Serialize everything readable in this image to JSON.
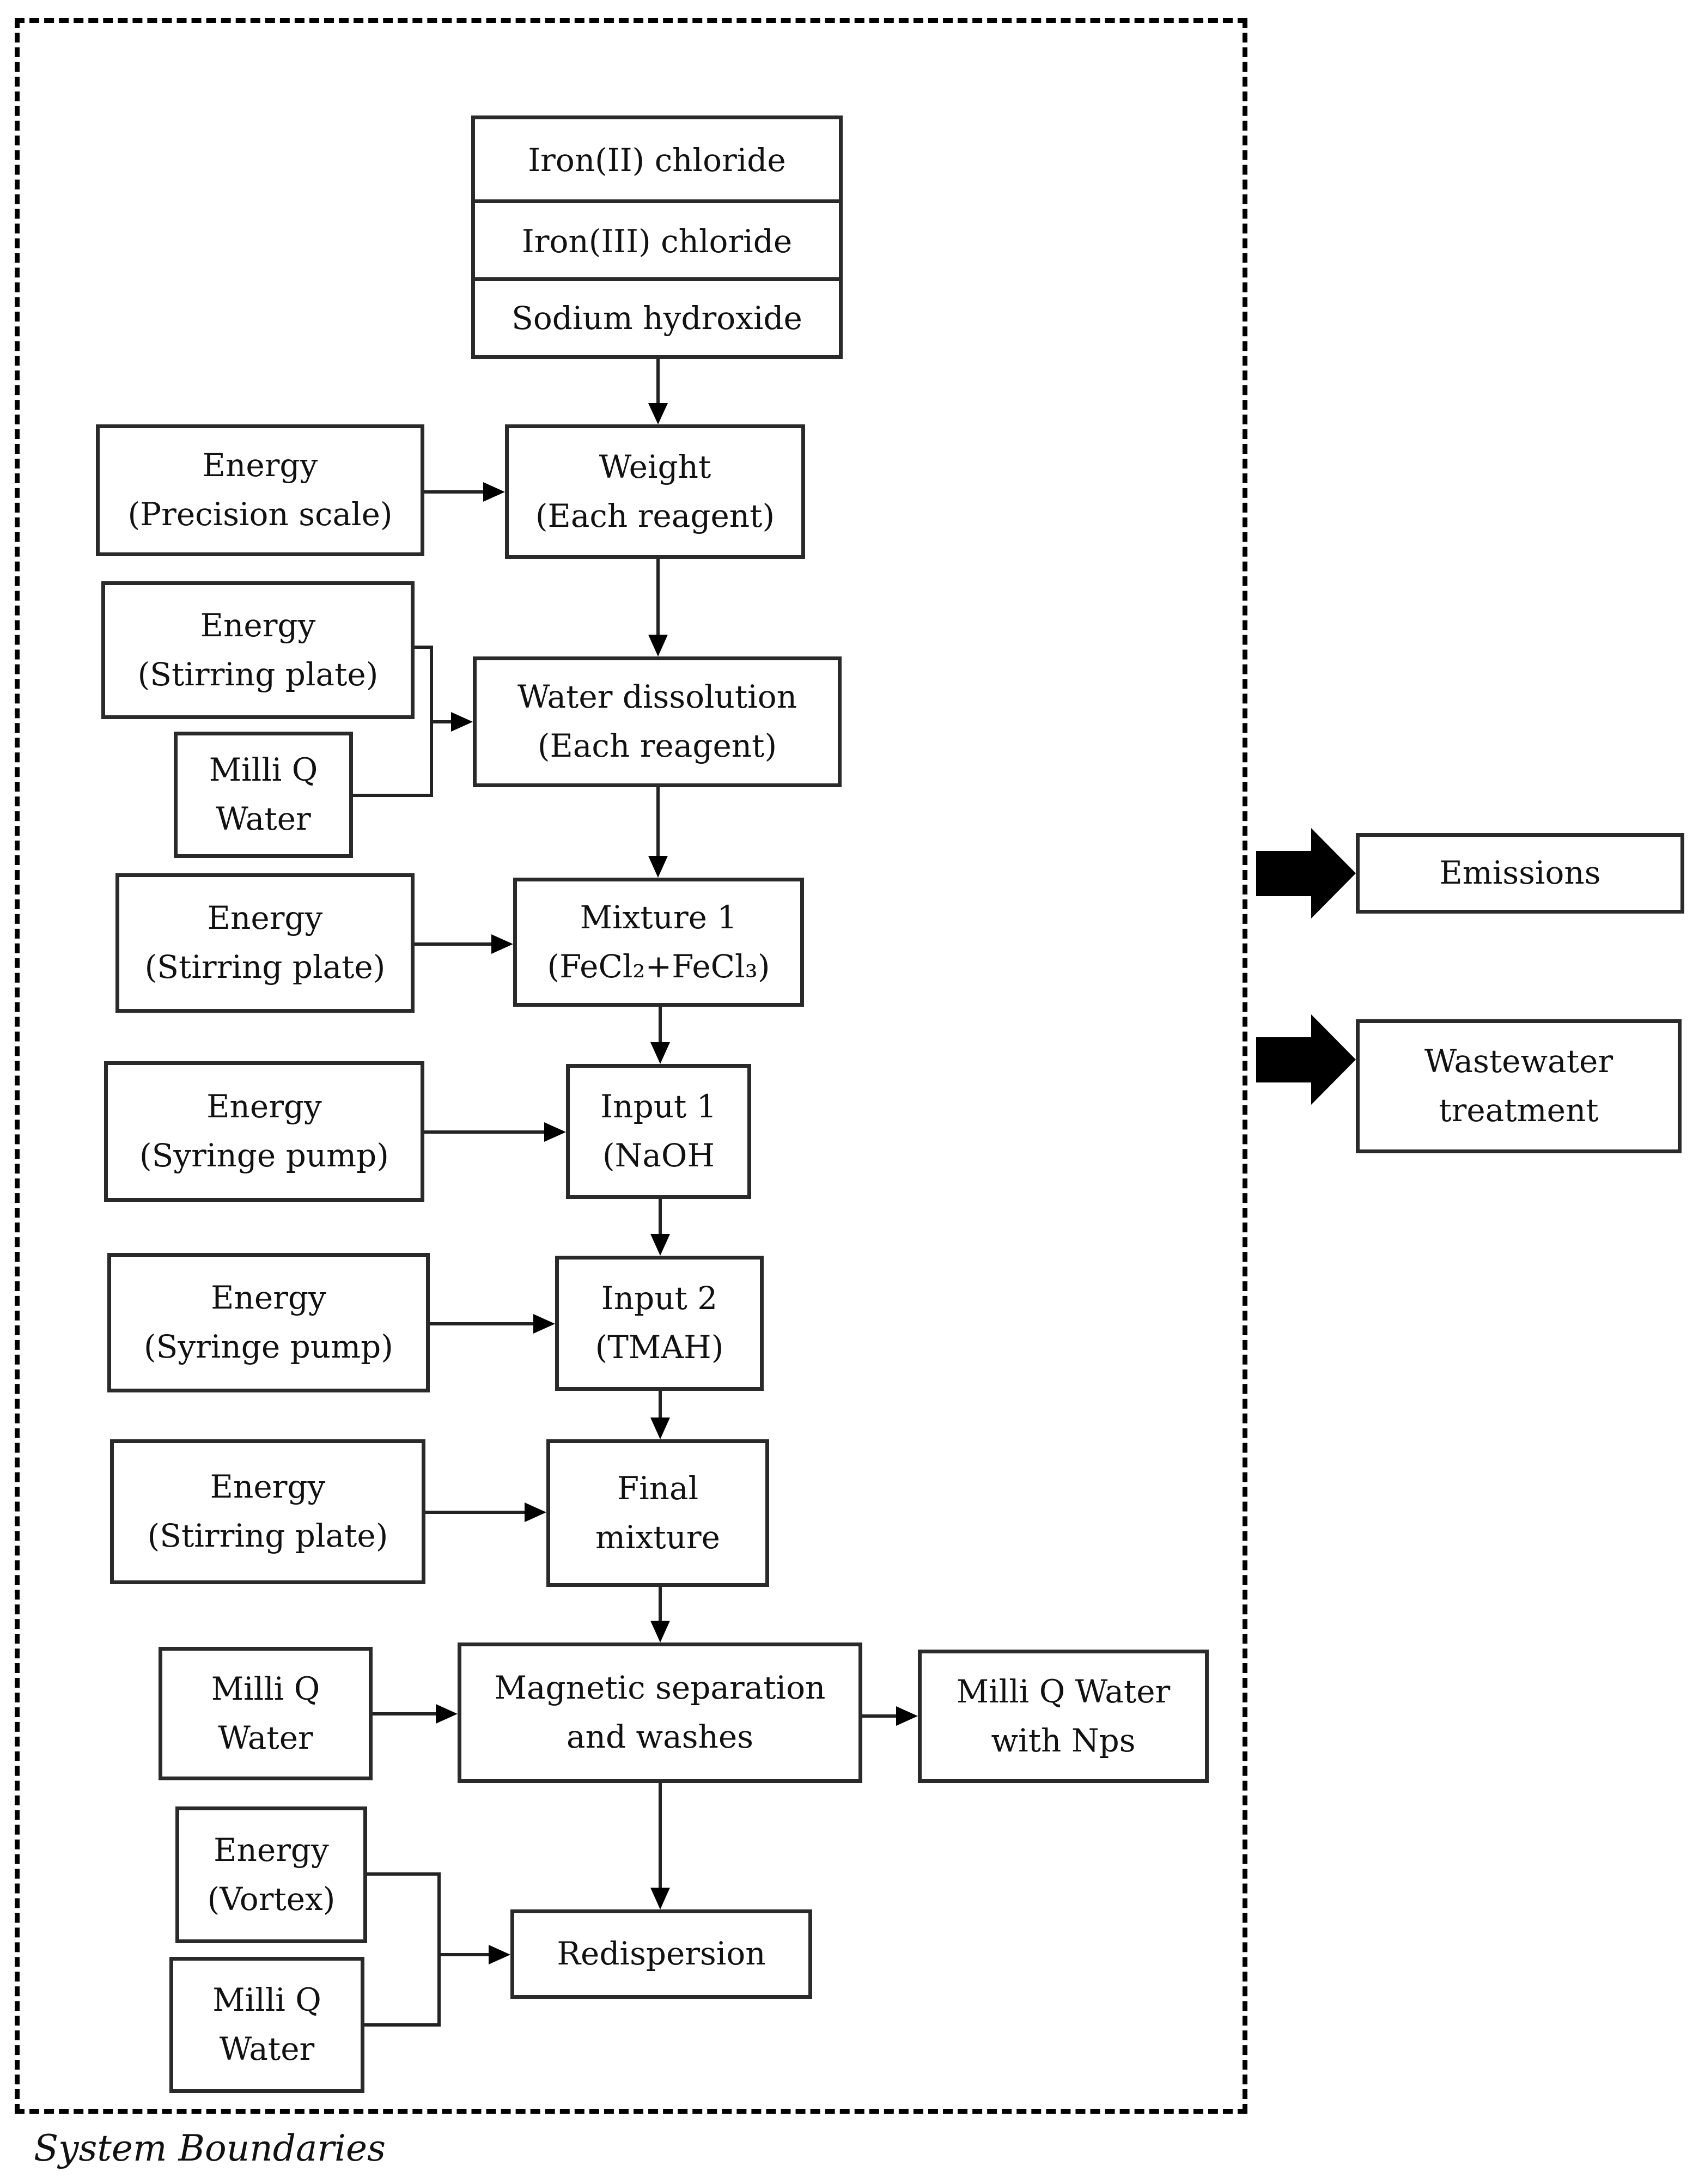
{
  "boundary": {
    "label": "System Boundaries"
  },
  "reagents": {
    "items": [
      "Iron(II) chloride",
      "Iron(III) chloride",
      "Sodium hydroxide"
    ]
  },
  "process_steps": [
    {
      "id": "weight",
      "lines": [
        "Weight",
        "(Each reagent)"
      ]
    },
    {
      "id": "water-dissolution",
      "lines": [
        "Water dissolution",
        "(Each reagent)"
      ]
    },
    {
      "id": "mixture-1",
      "lines": [
        "Mixture 1",
        "(FeCl₂+FeCl₃)"
      ]
    },
    {
      "id": "input-1",
      "lines": [
        "Input 1",
        "(NaOH"
      ]
    },
    {
      "id": "input-2",
      "lines": [
        "Input 2",
        "(TMAH)"
      ]
    },
    {
      "id": "final-mixture",
      "lines": [
        "Final",
        "mixture"
      ]
    },
    {
      "id": "magnetic-separation",
      "lines": [
        "Magnetic separation",
        "and washes"
      ]
    },
    {
      "id": "redispersion",
      "lines": [
        "Redispersion"
      ]
    }
  ],
  "inputs": [
    {
      "id": "energy-precision-scale",
      "lines": [
        "Energy",
        "(Precision scale)"
      ]
    },
    {
      "id": "energy-stirring-plate-1",
      "lines": [
        "Energy",
        "(Stirring plate)"
      ]
    },
    {
      "id": "milli-q-water-1",
      "lines": [
        "Milli Q",
        "Water"
      ]
    },
    {
      "id": "energy-stirring-plate-2",
      "lines": [
        "Energy",
        "(Stirring plate)"
      ]
    },
    {
      "id": "energy-syringe-pump-1",
      "lines": [
        "Energy",
        "(Syringe pump)"
      ]
    },
    {
      "id": "energy-syringe-pump-2",
      "lines": [
        "Energy",
        "(Syringe pump)"
      ]
    },
    {
      "id": "energy-stirring-plate-3",
      "lines": [
        "Energy",
        "(Stirring plate)"
      ]
    },
    {
      "id": "milli-q-water-2",
      "lines": [
        "Milli Q",
        "Water"
      ]
    },
    {
      "id": "energy-vortex",
      "lines": [
        "Energy",
        "(Vortex)"
      ]
    },
    {
      "id": "milli-q-water-3",
      "lines": [
        "Milli Q",
        "Water"
      ]
    }
  ],
  "outputs": [
    {
      "id": "milli-q-water-with-nps",
      "lines": [
        "Milli Q Water",
        "with Nps"
      ]
    }
  ],
  "external_outputs": [
    {
      "id": "emissions",
      "lines": [
        "Emissions"
      ]
    },
    {
      "id": "wastewater-treatment",
      "lines": [
        "Wastewater",
        "treatment"
      ]
    }
  ]
}
